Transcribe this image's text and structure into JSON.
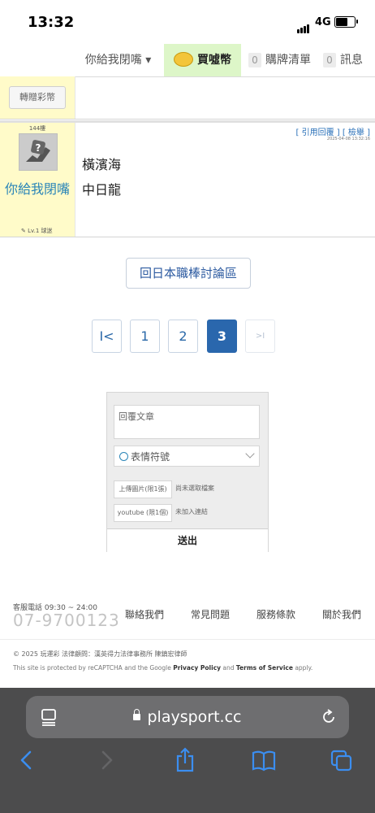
{
  "status_bar": {
    "time": "13:32",
    "network": "4G"
  },
  "nav": {
    "user_menu": "你給我閉嘴 ▾",
    "buy_coins": "買噓幣",
    "list_count": "0",
    "list_label": "購牌清單",
    "msg_count": "0",
    "msg_label": "訊息"
  },
  "gift_button": "轉贈彩幣",
  "post": {
    "floor": "144樓",
    "author": "你給我閉嘴",
    "level": "✎ Lv.1 球迷",
    "actions": "[ 引用回覆 ] [ 檢舉 ]",
    "date": "2025-04-08 13:32:16",
    "lines": [
      "橫濱海",
      "中日龍"
    ]
  },
  "back_button": "回日本職棒討論區",
  "pagination": {
    "first": "I<",
    "pages": [
      "1",
      "2",
      "3"
    ],
    "next": ">I",
    "current": "3"
  },
  "reply_form": {
    "placeholder": "回覆文章",
    "emoji_label": "表情符號",
    "upload_label": "上傳圖片(限1張)",
    "upload_status": "尚未選取檔案",
    "youtube_label": "youtube (限1個)",
    "youtube_status": "未加入連結",
    "submit_label": "送出"
  },
  "footer": {
    "service_label": "客服電話 09:30 ~ 24:00",
    "phone": "07-9700123",
    "links": [
      "聯絡我們",
      "常見問題",
      "服務條款",
      "關於我們"
    ],
    "copyright": "© 2025 玩運彩 法律顧問：漢英得力法律事務所 陳鎮宏律師",
    "recaptcha_prefix": "This site is protected by reCAPTCHA and the Google ",
    "privacy": "Privacy Policy",
    "and": " and ",
    "terms": "Terms of Service",
    "apply": " apply."
  },
  "browser": {
    "url": "playsport.cc"
  }
}
